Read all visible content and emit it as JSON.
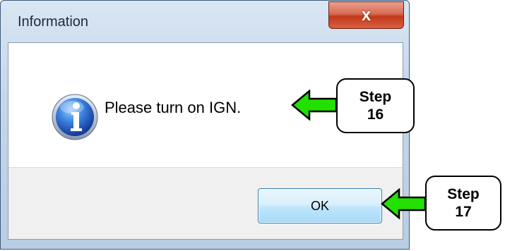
{
  "dialog": {
    "title": "Information",
    "close_glyph": "x",
    "message": "Please turn on IGN.",
    "icon": "info-icon",
    "ok_label": "OK"
  },
  "annotations": [
    {
      "word": "Step",
      "number": "16",
      "target": "message"
    },
    {
      "word": "Step",
      "number": "17",
      "target": "ok-button"
    }
  ],
  "colors": {
    "arrow_fill": "#22e000",
    "arrow_stroke": "#000000",
    "info_blue": "#1a4fb0"
  }
}
